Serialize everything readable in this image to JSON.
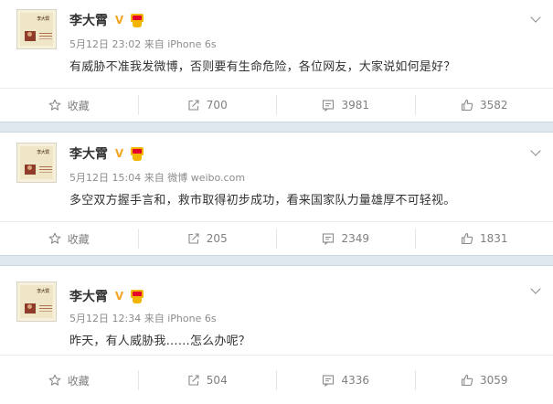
{
  "posts": [
    {
      "author": "李大霄",
      "verified_icon": "V",
      "date": "5月12日",
      "time": "23:02",
      "source_prefix": "来自",
      "source": "iPhone 6s",
      "text": "有威胁不准我发微博，否则要有生命危险，各位网友，大家说如何是好？",
      "actions": {
        "collect_label": "收藏",
        "repost_count": "700",
        "comment_count": "3981",
        "like_count": "3582"
      }
    },
    {
      "author": "李大霄",
      "verified_icon": "V",
      "date": "5月12日",
      "time": "15:04",
      "source_prefix": "来自",
      "source": "微博 weibo.com",
      "text": "多空双方握手言和，救市取得初步成功，看来国家队力量雄厚不可轻视。",
      "actions": {
        "collect_label": "收藏",
        "repost_count": "205",
        "comment_count": "2349",
        "like_count": "1831"
      }
    },
    {
      "author": "李大霄",
      "verified_icon": "V",
      "date": "5月12日",
      "time": "12:34",
      "source_prefix": "来自",
      "source": "iPhone 6s",
      "text": "昨天，有人威胁我……怎么办呢？",
      "actions": {
        "collect_label": "收藏",
        "repost_count": "504",
        "comment_count": "4336",
        "like_count": "3059"
      }
    }
  ],
  "avatar_title": "李大霄",
  "icons": {
    "verified": "verified-v-icon",
    "member": "member-crown-icon",
    "menu": "chevron-down-icon",
    "collect": "star-icon",
    "repost": "share-box-icon",
    "comment": "comment-box-icon",
    "like": "thumbs-up-icon"
  },
  "colors": {
    "accent_verified": "#f5a623",
    "separator": "#dfe8ee",
    "text": "#333333",
    "meta": "#8c8c8c"
  }
}
